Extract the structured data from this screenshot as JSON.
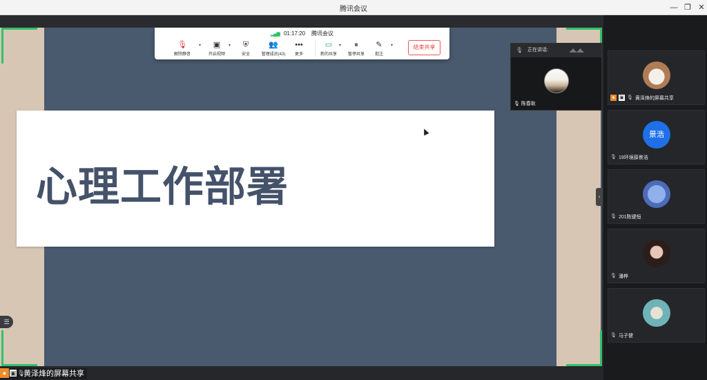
{
  "window": {
    "title": "腾讯会议",
    "minimize_glyph": "—",
    "restore_glyph": "❐",
    "close_glyph": "✕"
  },
  "toolbar": {
    "signal_icon": "signal-icon",
    "timer": "01:17:20",
    "meeting_name": "腾讯会议",
    "items": [
      {
        "label": "解除静音",
        "icon": "mic-muted-icon",
        "glyph": "🎙"
      },
      {
        "label": "开启视频",
        "icon": "video-off-icon",
        "glyph": "▣"
      },
      {
        "label": "安全",
        "icon": "shield-icon",
        "glyph": "⛨"
      },
      {
        "label": "管理成员(43)",
        "icon": "members-icon",
        "glyph": "👥"
      },
      {
        "label": "更多",
        "icon": "more-icon",
        "glyph": "•••"
      },
      {
        "label": "新的共享",
        "icon": "new-share-icon",
        "glyph": "▭"
      },
      {
        "label": "暂停共享",
        "icon": "pause-share-icon",
        "glyph": "⏸"
      },
      {
        "label": "批注",
        "icon": "annotate-icon",
        "glyph": "✎"
      }
    ],
    "caret_glyph": "▾",
    "end_share_label": "结束共享",
    "end_share_color": "#e44444"
  },
  "slide": {
    "title": "心理工作部署"
  },
  "speaking": {
    "header": "正在讲话:",
    "name": "陈春耿"
  },
  "participants": [
    {
      "name": "黄泽烽的屏幕共享",
      "is_host": true,
      "is_sharing": true,
      "avatar": "cartoon-avatar"
    },
    {
      "name": "19环境薛景浩",
      "avatar_text": "景浩",
      "avatar_color": "#1f6fe8"
    },
    {
      "name": "201陈键恒",
      "avatar": "cartoon-avatar"
    },
    {
      "name": "潘桦",
      "avatar": "photo-avatar"
    },
    {
      "name": "马子健",
      "avatar": "cartoon-avatar"
    }
  ],
  "bottom": {
    "sharer_label": "黄泽烽的屏幕共享"
  },
  "colors": {
    "share_frame": "#2fc26a",
    "slide_title": "#44526a",
    "host_badge": "#f08c2c"
  }
}
